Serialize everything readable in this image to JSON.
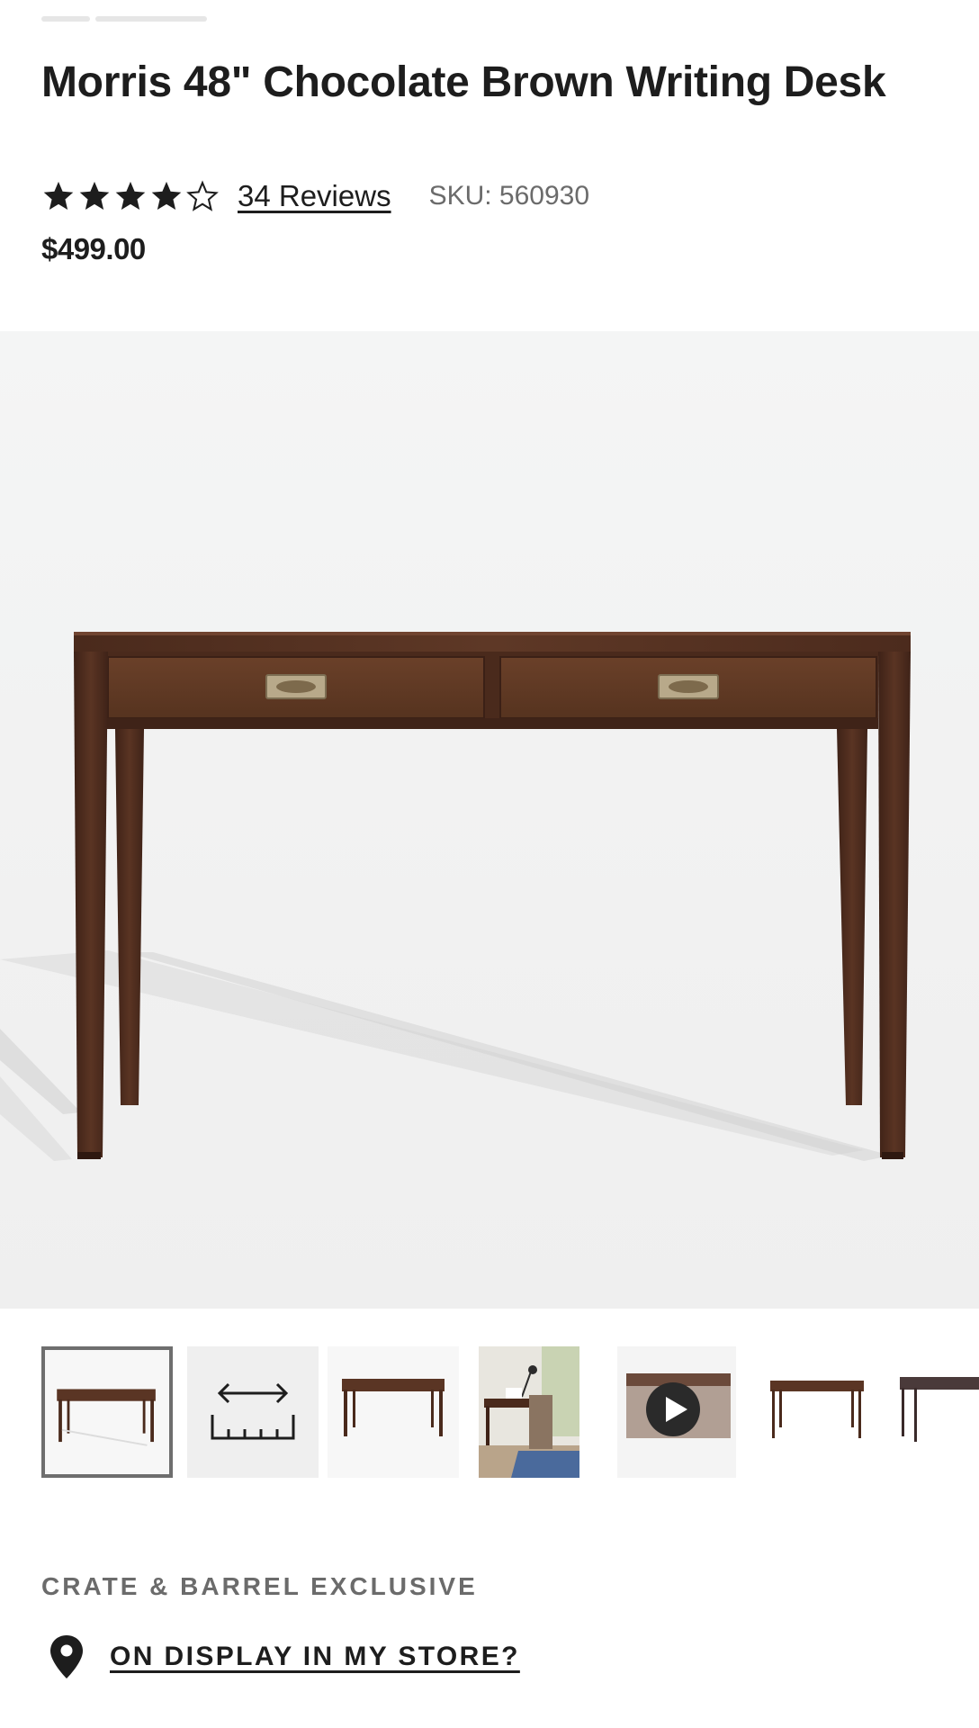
{
  "product": {
    "title": "Morris 48\" Chocolate Brown Writing Desk",
    "rating": 4,
    "rating_max": 5,
    "reviews_label": "34 Reviews",
    "sku_label": "SKU: 560930",
    "price": "$499.00"
  },
  "gallery": {
    "hero_image_icon": "desk-photo",
    "thumbnails": [
      {
        "icon": "desk-front-thumb",
        "selected": true
      },
      {
        "icon": "dimensions-ruler-icon",
        "selected": false
      },
      {
        "icon": "desk-front-thumb",
        "selected": false
      },
      {
        "icon": "desk-room-scene-thumb",
        "selected": false
      },
      {
        "icon": "video-play-thumb",
        "selected": false
      },
      {
        "icon": "desk-side-thumb",
        "selected": false
      },
      {
        "icon": "desk-angle-thumb",
        "selected": false
      }
    ]
  },
  "info": {
    "exclusive_label": "CRATE & BARREL EXCLUSIVE",
    "store_link": "ON DISPLAY IN MY STORE?"
  },
  "colors": {
    "text": "#1d1d1d",
    "muted": "#6b6b6b",
    "wood": "#5a3524",
    "hero_bg": "#f2f2f2",
    "selected_border": "#6e6e6e"
  }
}
